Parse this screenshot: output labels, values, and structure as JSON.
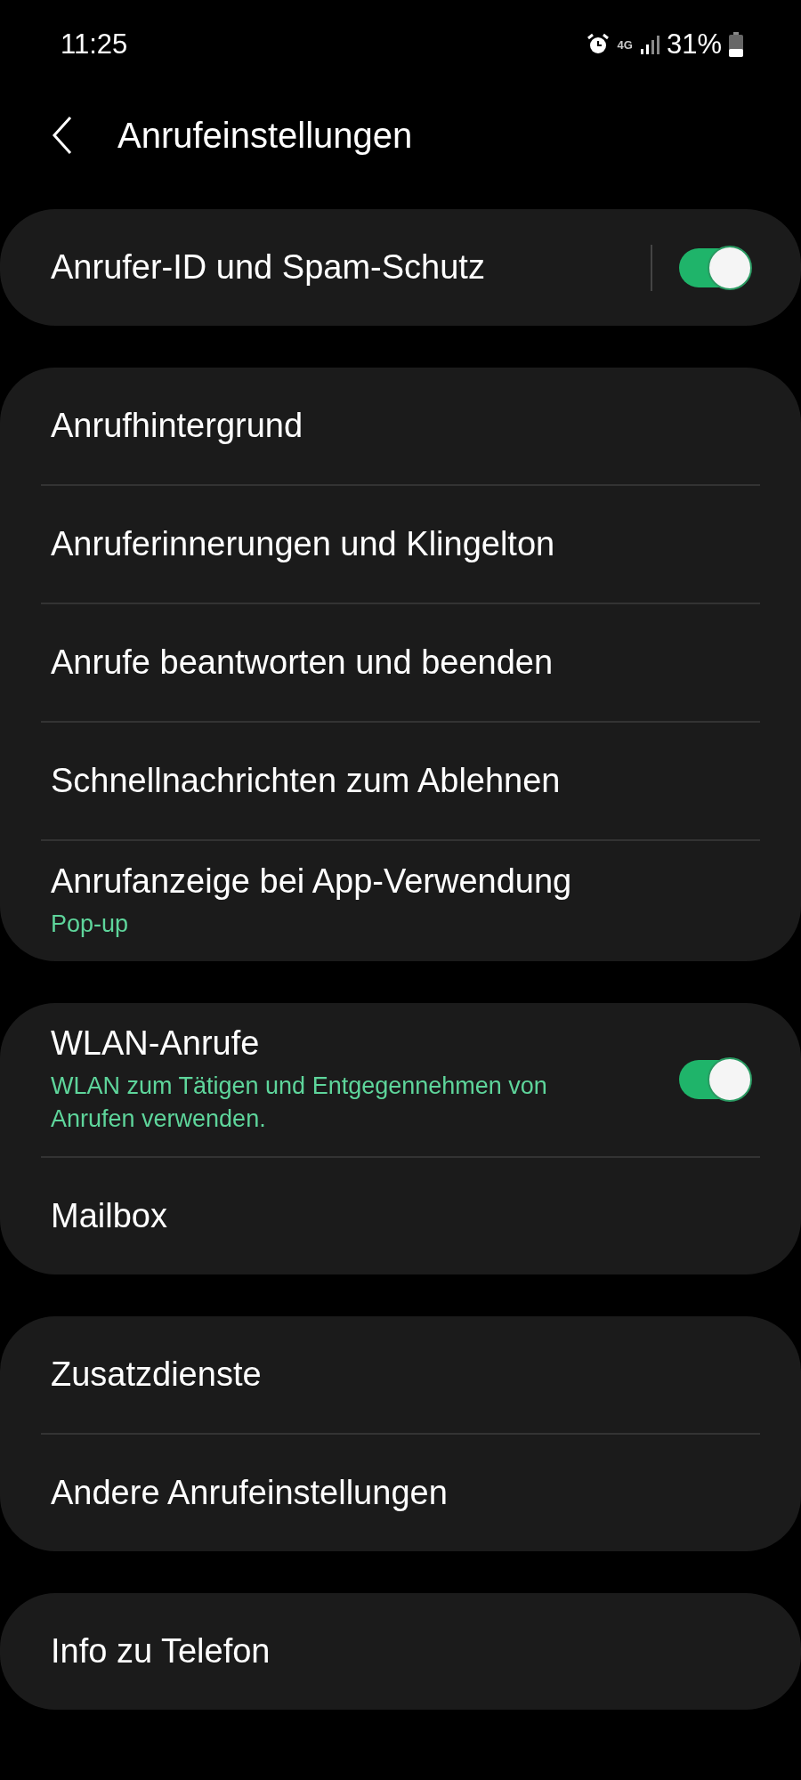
{
  "status_bar": {
    "time": "11:25",
    "network": "4G",
    "battery": "31%"
  },
  "header": {
    "title": "Anrufeinstellungen"
  },
  "sections": [
    {
      "items": [
        {
          "kind": "split-toggle",
          "label": "Anrufer-ID und Spam-Schutz",
          "on": true
        }
      ]
    },
    {
      "items": [
        {
          "kind": "link",
          "label": "Anrufhintergrund"
        },
        {
          "kind": "link",
          "label": "Anruferinnerungen und Klingelton"
        },
        {
          "kind": "link",
          "label": "Anrufe beantworten und beenden"
        },
        {
          "kind": "link",
          "label": "Schnellnachrichten zum Ablehnen"
        },
        {
          "kind": "link",
          "label": "Anrufanzeige bei App-Verwendung",
          "subtitle": "Pop-up"
        }
      ]
    },
    {
      "items": [
        {
          "kind": "toggle",
          "label": "WLAN-Anrufe",
          "subtitle": "WLAN zum Tätigen und Entgegennehmen von Anrufen verwenden.",
          "on": true
        },
        {
          "kind": "link",
          "label": "Mailbox"
        }
      ]
    },
    {
      "items": [
        {
          "kind": "link",
          "label": "Zusatzdienste"
        },
        {
          "kind": "link",
          "label": "Andere Anrufeinstellungen"
        }
      ]
    },
    {
      "items": [
        {
          "kind": "link",
          "label": "Info zu Telefon"
        }
      ]
    }
  ]
}
